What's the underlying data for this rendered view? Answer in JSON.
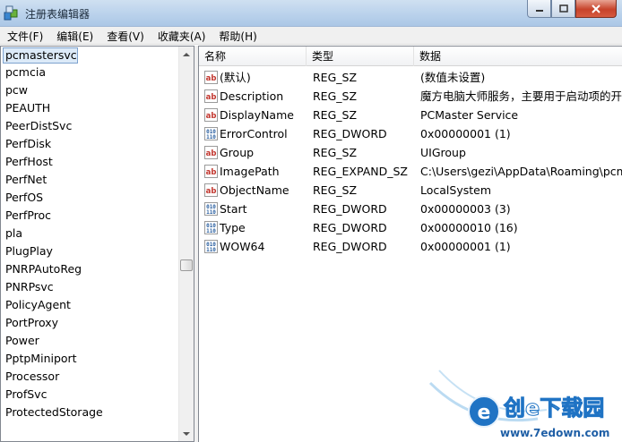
{
  "window": {
    "title": "注册表编辑器"
  },
  "menu": [
    "文件(F)",
    "编辑(E)",
    "查看(V)",
    "收藏夹(A)",
    "帮助(H)"
  ],
  "tree": {
    "selected": "pcmastersvc",
    "items": [
      "pcmcia",
      "pcw",
      "PEAUTH",
      "PeerDistSvc",
      "PerfDisk",
      "PerfHost",
      "PerfNet",
      "PerfOS",
      "PerfProc",
      "pla",
      "PlugPlay",
      "PNRPAutoReg",
      "PNRPsvc",
      "PolicyAgent",
      "PortProxy",
      "Power",
      "PptpMiniport",
      "Processor",
      "ProfSvc",
      "ProtectedStorage"
    ]
  },
  "columns": {
    "name": "名称",
    "type": "类型",
    "data": "数据"
  },
  "values": [
    {
      "icon": "string-value-icon",
      "name": "(默认)",
      "type": "REG_SZ",
      "data": "(数值未设置)"
    },
    {
      "icon": "string-value-icon",
      "name": "Description",
      "type": "REG_SZ",
      "data": "魔方电脑大师服务，主要用于启动项的开机"
    },
    {
      "icon": "string-value-icon",
      "name": "DisplayName",
      "type": "REG_SZ",
      "data": "PCMaster Service"
    },
    {
      "icon": "binary-value-icon",
      "name": "ErrorControl",
      "type": "REG_DWORD",
      "data": "0x00000001 (1)"
    },
    {
      "icon": "string-value-icon",
      "name": "Group",
      "type": "REG_SZ",
      "data": "UIGroup"
    },
    {
      "icon": "string-value-icon",
      "name": "ImagePath",
      "type": "REG_EXPAND_SZ",
      "data": "C:\\Users\\gezi\\AppData\\Roaming\\pcma"
    },
    {
      "icon": "string-value-icon",
      "name": "ObjectName",
      "type": "REG_SZ",
      "data": "LocalSystem"
    },
    {
      "icon": "binary-value-icon",
      "name": "Start",
      "type": "REG_DWORD",
      "data": "0x00000003 (3)"
    },
    {
      "icon": "binary-value-icon",
      "name": "Type",
      "type": "REG_DWORD",
      "data": "0x00000010 (16)"
    },
    {
      "icon": "binary-value-icon",
      "name": "WOW64",
      "type": "REG_DWORD",
      "data": "0x00000001 (1)"
    }
  ],
  "watermark": {
    "brand": "创e下载园",
    "url": "www.7edown.com"
  }
}
